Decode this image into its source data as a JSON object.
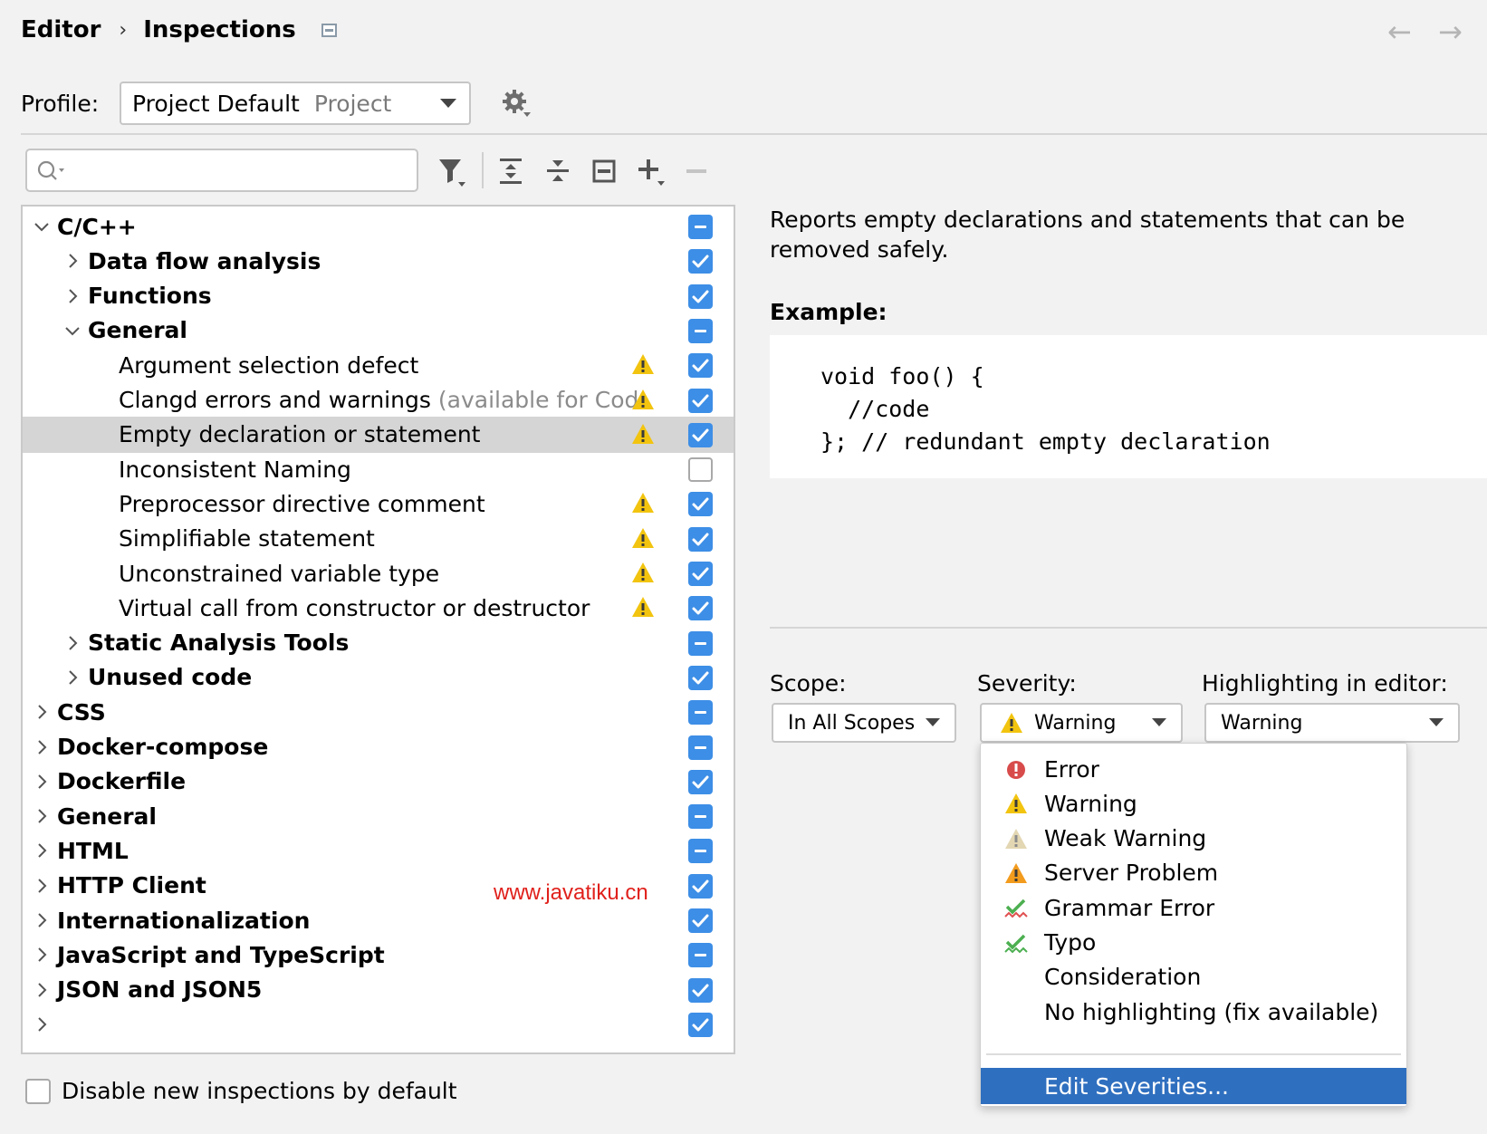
{
  "breadcrumb": {
    "parent": "Editor",
    "separator": "›",
    "current": "Inspections"
  },
  "nav": {
    "back": "←",
    "forward": "→"
  },
  "profile": {
    "label": "Profile:",
    "name": "Project Default",
    "scope": "Project"
  },
  "search": {
    "placeholder": ""
  },
  "toolbar": {
    "icons": [
      "filter-icon",
      "expand-all-icon",
      "collapse-all-icon",
      "reset-icon",
      "add-icon",
      "remove-icon"
    ]
  },
  "tree": [
    {
      "label": "C/C++",
      "level": 0,
      "expanded": true,
      "bold": true,
      "state": "mixed"
    },
    {
      "label": "Data flow analysis",
      "level": 1,
      "expanded": false,
      "bold": true,
      "state": "checked"
    },
    {
      "label": "Functions",
      "level": 1,
      "expanded": false,
      "bold": true,
      "state": "checked"
    },
    {
      "label": "General",
      "level": 1,
      "expanded": true,
      "bold": true,
      "state": "mixed"
    },
    {
      "label": "Argument selection defect",
      "level": 2,
      "warning": true,
      "state": "checked"
    },
    {
      "label": "Clangd errors and warnings",
      "hint": "(available for Cod",
      "level": 2,
      "warning": true,
      "state": "checked"
    },
    {
      "label": "Empty declaration or statement",
      "level": 2,
      "warning": true,
      "state": "checked",
      "selected": true
    },
    {
      "label": "Inconsistent Naming",
      "level": 2,
      "warning": false,
      "state": "empty"
    },
    {
      "label": "Preprocessor directive comment",
      "level": 2,
      "warning": true,
      "state": "checked"
    },
    {
      "label": "Simplifiable statement",
      "level": 2,
      "warning": true,
      "state": "checked"
    },
    {
      "label": "Unconstrained variable type",
      "level": 2,
      "warning": true,
      "state": "checked"
    },
    {
      "label": "Virtual call from constructor or destructor",
      "level": 2,
      "warning": true,
      "state": "checked"
    },
    {
      "label": "Static Analysis Tools",
      "level": 1,
      "expanded": false,
      "bold": true,
      "state": "mixed"
    },
    {
      "label": "Unused code",
      "level": 1,
      "expanded": false,
      "bold": true,
      "state": "checked"
    },
    {
      "label": "CSS",
      "level": 0,
      "expanded": false,
      "bold": true,
      "state": "mixed"
    },
    {
      "label": "Docker-compose",
      "level": 0,
      "expanded": false,
      "bold": true,
      "state": "mixed"
    },
    {
      "label": "Dockerfile",
      "level": 0,
      "expanded": false,
      "bold": true,
      "state": "checked"
    },
    {
      "label": "General",
      "level": 0,
      "expanded": false,
      "bold": true,
      "state": "mixed"
    },
    {
      "label": "HTML",
      "level": 0,
      "expanded": false,
      "bold": true,
      "state": "mixed"
    },
    {
      "label": "HTTP Client",
      "level": 0,
      "expanded": false,
      "bold": true,
      "state": "checked"
    },
    {
      "label": "Internationalization",
      "level": 0,
      "expanded": false,
      "bold": true,
      "state": "checked"
    },
    {
      "label": "JavaScript and TypeScript",
      "level": 0,
      "expanded": false,
      "bold": true,
      "state": "mixed"
    },
    {
      "label": "JSON and JSON5",
      "level": 0,
      "expanded": false,
      "bold": true,
      "state": "checked"
    },
    {
      "label": "",
      "level": 0,
      "expanded": false,
      "bold": true,
      "state": "checked"
    }
  ],
  "watermark": "www.javatiku.cn",
  "disable_new": {
    "label": "Disable new inspections by default",
    "checked": false
  },
  "description": {
    "text": "Reports empty declarations and statements that can be removed safely.",
    "example_title": "Example:",
    "code": "void foo() {\n  //code\n}; // redundant empty declaration"
  },
  "options": {
    "scope_label": "Scope:",
    "scope_value": "In All Scopes",
    "severity_label": "Severity:",
    "severity_value": "Warning",
    "highlight_label": "Highlighting in editor:",
    "highlight_value": "Warning"
  },
  "severity_menu": [
    {
      "label": "Error",
      "icon": "error-icon"
    },
    {
      "label": "Warning",
      "icon": "warning-icon"
    },
    {
      "label": "Weak Warning",
      "icon": "weak-warning-icon"
    },
    {
      "label": "Server Problem",
      "icon": "server-problem-icon"
    },
    {
      "label": "Grammar Error",
      "icon": "grammar-error-icon"
    },
    {
      "label": "Typo",
      "icon": "typo-icon"
    },
    {
      "label": "Consideration",
      "icon": ""
    },
    {
      "label": "No highlighting (fix available)",
      "icon": ""
    }
  ],
  "edit_severities": "Edit Severities...",
  "colors": {
    "accent": "#3d8ee6",
    "selection": "#2f6fbf",
    "warning": "#f2c40f",
    "error": "#d84b4b",
    "server_problem": "#f29b1d"
  }
}
